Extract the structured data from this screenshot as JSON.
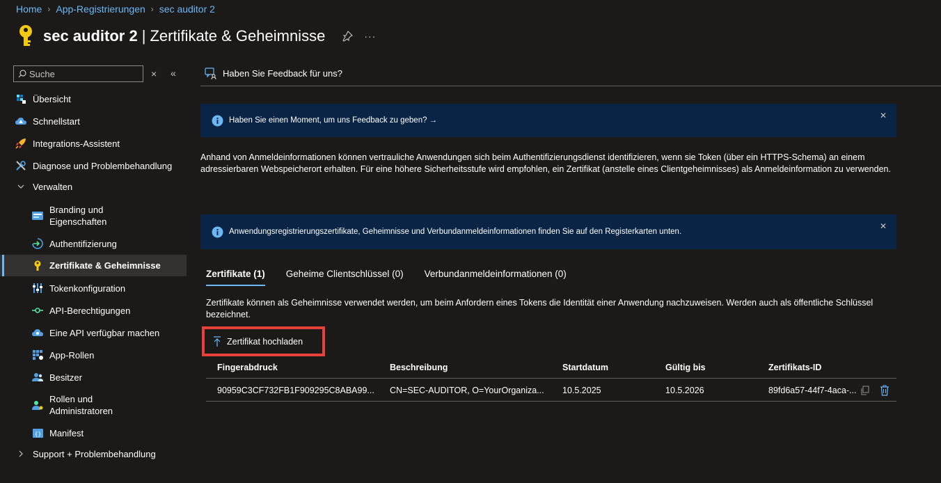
{
  "breadcrumb": {
    "home": "Home",
    "app_regs": "App-Registrierungen",
    "app": "sec auditor 2"
  },
  "header": {
    "app_name": "sec auditor 2",
    "separator": "|",
    "page_title": "Zertifikate & Geheimnisse",
    "more": "···"
  },
  "search": {
    "placeholder": "Suche",
    "clear": "×",
    "collapse": "«"
  },
  "sidebar": {
    "items": [
      {
        "label": "Übersicht",
        "icon": "overview-icon"
      },
      {
        "label": "Schnellstart",
        "icon": "quickstart-cloud-icon"
      },
      {
        "label": "Integrations-Assistent",
        "icon": "rocket-icon"
      },
      {
        "label": "Diagnose und Problembehandlung",
        "icon": "wrench-icon"
      },
      {
        "label": "Verwalten",
        "icon": "chevron-down-icon"
      },
      {
        "label": "Branding und Eigenschaften",
        "icon": "branding-icon"
      },
      {
        "label": "Authentifizierung",
        "icon": "authentication-icon"
      },
      {
        "label": "Zertifikate & Geheimnisse",
        "icon": "key-icon"
      },
      {
        "label": "Tokenkonfiguration",
        "icon": "token-config-icon"
      },
      {
        "label": "API-Berechtigungen",
        "icon": "api-permissions-icon"
      },
      {
        "label": "Eine API verfügbar machen",
        "icon": "expose-api-cloud-icon"
      },
      {
        "label": "App-Rollen",
        "icon": "app-roles-icon"
      },
      {
        "label": "Besitzer",
        "icon": "owners-icon"
      },
      {
        "label": "Rollen und Administratoren",
        "icon": "roles-admins-icon"
      },
      {
        "label": "Manifest",
        "icon": "manifest-icon"
      },
      {
        "label": "Support + Problembehandlung",
        "icon": "chevron-right-icon"
      }
    ]
  },
  "feedback": {
    "label": "Haben Sie Feedback für uns?"
  },
  "banners": [
    {
      "text": "Haben Sie einen Moment, um uns Feedback zu geben? →"
    },
    {
      "text": "Anwendungsregistrierungszertifikate, Geheimnisse und Verbundanmeldeinformationen finden Sie auf den Registerkarten unten."
    }
  ],
  "description": "Anhand von Anmeldeinformationen können vertrauliche Anwendungen sich beim Authentifizierungsdienst identifizieren, wenn sie Token (über ein HTTPS-Schema) an einem adressierbaren Webspeicherort erhalten. Für eine höhere Sicherheitsstufe wird empfohlen, ein Zertifikat (anstelle eines Clientgeheimnisses) als Anmeldeinformation zu verwenden.",
  "tabs": [
    {
      "label": "Zertifikate (1)",
      "active": true
    },
    {
      "label": "Geheime Clientschlüssel (0)",
      "active": false
    },
    {
      "label": "Verbundanmeldeinformationen (0)",
      "active": false
    }
  ],
  "tab_description": "Zertifikate können als Geheimnisse verwendet werden, um beim Anfordern eines Tokens die Identität einer Anwendung nachzuweisen. Werden auch als öffentliche Schlüssel bezeichnet.",
  "upload_button": "Zertifikat hochladen",
  "table": {
    "headers": [
      "Fingerabdruck",
      "Beschreibung",
      "Startdatum",
      "Gültig bis",
      "Zertifikats-ID"
    ],
    "rows": [
      [
        "90959C3CF732FB1F909295C8ABA99...",
        "CN=SEC-AUDITOR, O=YourOrganiza...",
        "10.5.2025",
        "10.5.2026",
        "89fd6a57-44f7-4aca-..."
      ]
    ]
  },
  "colors": {
    "accent": "#6cb8f6",
    "banner_bg": "#0a2445",
    "highlight_border": "#e8413c",
    "background": "#1b1a19"
  }
}
